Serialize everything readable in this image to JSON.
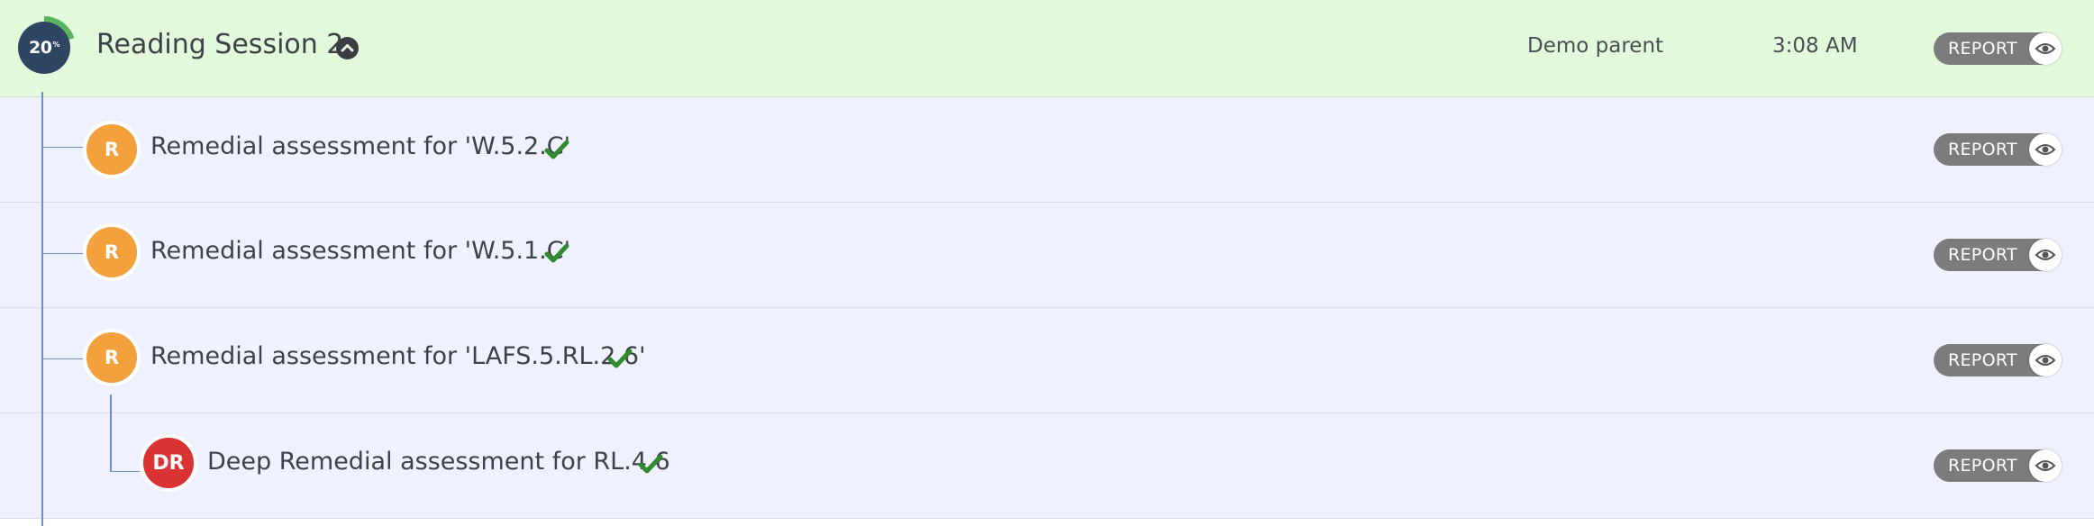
{
  "session": {
    "progress_value": "20",
    "progress_unit": "%",
    "progress_fraction": 0.2,
    "title": "Reading Session 2",
    "user": "Demo parent",
    "time": "3:08 AM",
    "report_label": "REPORT"
  },
  "assessments": [
    {
      "badge": "R",
      "title": "Remedial assessment for 'W.5.2.C'",
      "status": "completed",
      "report_label": "REPORT"
    },
    {
      "badge": "R",
      "title": "Remedial assessment for 'W.5.1.C'",
      "status": "completed",
      "report_label": "REPORT"
    },
    {
      "badge": "R",
      "title": "Remedial assessment for 'LAFS.5.RL.2.6'",
      "status": "completed",
      "report_label": "REPORT"
    },
    {
      "badge": "DR",
      "title": "Deep Remedial assessment for RL.4.6",
      "status": "completed",
      "report_label": "REPORT"
    }
  ],
  "icons": {
    "collapse": "chevron-up-icon",
    "check": "check-icon",
    "report": "eye-icon"
  },
  "colors": {
    "session_bg": "#e3f9dc",
    "row_bg": "#eff2fe",
    "progress_ring": "#5ab45c",
    "progress_circle": "#2f4662",
    "remedial_badge": "#f3a13c",
    "deep_remedial_badge": "#d93433",
    "check": "#2e8b2e",
    "report_button": "#7c7c7c",
    "tree_line": "#6f8fcf"
  }
}
